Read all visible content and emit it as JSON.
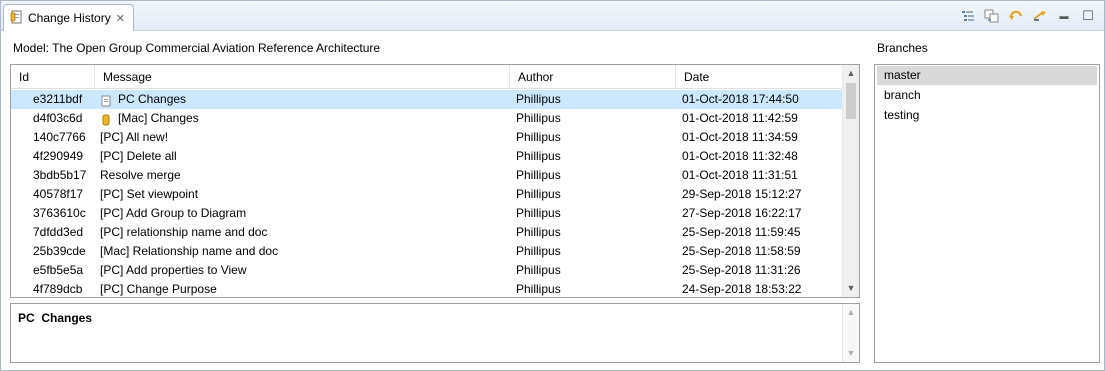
{
  "tab": {
    "title": "Change History",
    "close": "✕"
  },
  "toolbar": {
    "icons": [
      "collapse-tree-icon",
      "sync-icon",
      "revert-icon",
      "restore-icon",
      "minimize-icon",
      "maximize-icon"
    ],
    "minimize": "▬",
    "maximize": "☐"
  },
  "model_label": "Model: The Open Group Commercial Aviation Reference Architecture",
  "table": {
    "columns": [
      "Id",
      "Message",
      "Author",
      "Date"
    ],
    "rows": [
      {
        "id": "e3211bdf",
        "message": "PC Changes",
        "author": "Phillipus",
        "date": "01-Oct-2018 17:44:50",
        "selected": true,
        "icon": "note-icon"
      },
      {
        "id": "d4f03c6d",
        "message": "[Mac] Changes",
        "author": "Phillipus",
        "date": "01-Oct-2018 11:42:59",
        "selected": false,
        "icon": "tag-icon"
      },
      {
        "id": "140c7766",
        "message": "[PC] All new!",
        "author": "Phillipus",
        "date": "01-Oct-2018 11:34:59",
        "selected": false,
        "icon": ""
      },
      {
        "id": "4f290949",
        "message": "[PC] Delete all",
        "author": "Phillipus",
        "date": "01-Oct-2018 11:32:48",
        "selected": false,
        "icon": ""
      },
      {
        "id": "3bdb5b17",
        "message": "Resolve merge",
        "author": "Phillipus",
        "date": "01-Oct-2018 11:31:51",
        "selected": false,
        "icon": ""
      },
      {
        "id": "40578f17",
        "message": "[PC] Set viewpoint",
        "author": "Phillipus",
        "date": "29-Sep-2018 15:12:27",
        "selected": false,
        "icon": ""
      },
      {
        "id": "3763610c",
        "message": "[PC] Add Group to Diagram",
        "author": "Phillipus",
        "date": "27-Sep-2018 16:22:17",
        "selected": false,
        "icon": ""
      },
      {
        "id": "7dfdd3ed",
        "message": "[PC] relationship name and doc",
        "author": "Phillipus",
        "date": "25-Sep-2018 11:59:45",
        "selected": false,
        "icon": ""
      },
      {
        "id": "25b39cde",
        "message": "[Mac] Relationship name and doc",
        "author": "Phillipus",
        "date": "25-Sep-2018 11:58:59",
        "selected": false,
        "icon": ""
      },
      {
        "id": "e5fb5e5a",
        "message": "[PC] Add properties to View",
        "author": "Phillipus",
        "date": "25-Sep-2018 11:31:26",
        "selected": false,
        "icon": ""
      },
      {
        "id": "4f789dcb",
        "message": "[PC] Change Purpose",
        "author": "Phillipus",
        "date": "24-Sep-2018 18:53:22",
        "selected": false,
        "icon": ""
      }
    ]
  },
  "scroll": {
    "up": "▲",
    "down": "▼"
  },
  "comment": {
    "text": "PC  Changes"
  },
  "branches": {
    "label": "Branches",
    "items": [
      {
        "name": "master",
        "selected": true
      },
      {
        "name": "branch",
        "selected": false
      },
      {
        "name": "testing",
        "selected": false
      }
    ]
  },
  "colors": {
    "selected_row": "#cce8ff",
    "selected_branch": "#d9d9d9",
    "border": "#a0a0a0",
    "accent": "#e8a317"
  }
}
